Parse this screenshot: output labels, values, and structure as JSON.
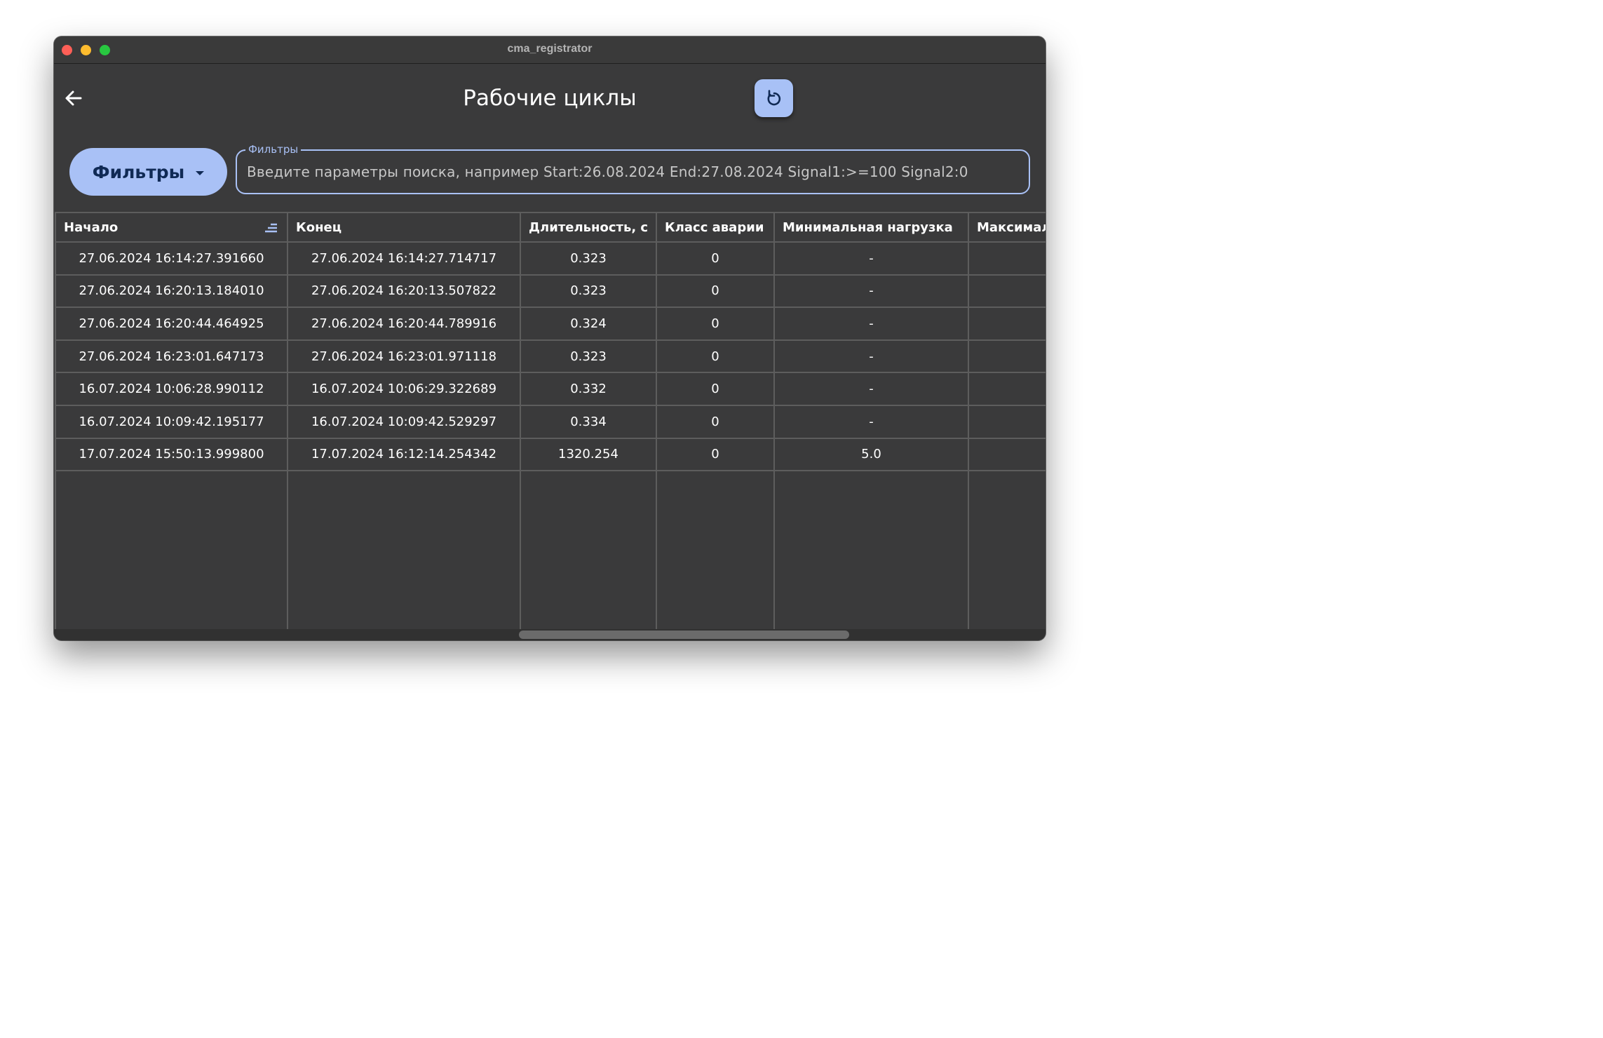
{
  "window": {
    "title": "cma_registrator"
  },
  "header": {
    "title": "Рабочие циклы",
    "back_icon": "arrow-left-icon",
    "refresh_icon": "refresh-icon"
  },
  "filters": {
    "button_label": "Фильтры",
    "field_label": "Фильтры",
    "placeholder": "Введите параметры поиска, например Start:26.08.2024 End:27.08.2024 Signal1:>=100 Signal2:0",
    "value": ""
  },
  "colors": {
    "accent": "#a9c1f6",
    "background": "#3a3a3b",
    "grid": "#5d5d5d"
  },
  "table": {
    "columns": [
      "Начало",
      "Конец",
      "Длительность, с",
      "Класс аварии",
      "Минимальная нагрузка",
      "Максимальная нагрузка"
    ],
    "sorted_column": "Начало",
    "rows": [
      [
        "27.06.2024 16:14:27.391660",
        "27.06.2024 16:14:27.714717",
        "0.323",
        "0",
        "-",
        ""
      ],
      [
        "27.06.2024 16:20:13.184010",
        "27.06.2024 16:20:13.507822",
        "0.323",
        "0",
        "-",
        ""
      ],
      [
        "27.06.2024 16:20:44.464925",
        "27.06.2024 16:20:44.789916",
        "0.324",
        "0",
        "-",
        ""
      ],
      [
        "27.06.2024 16:23:01.647173",
        "27.06.2024 16:23:01.971118",
        "0.323",
        "0",
        "-",
        ""
      ],
      [
        "16.07.2024 10:06:28.990112",
        "16.07.2024 10:06:29.322689",
        "0.332",
        "0",
        "-",
        ""
      ],
      [
        "16.07.2024 10:09:42.195177",
        "16.07.2024 10:09:42.529297",
        "0.334",
        "0",
        "-",
        ""
      ],
      [
        "17.07.2024 15:50:13.999800",
        "17.07.2024 16:12:14.254342",
        "1320.254",
        "0",
        "5.0",
        ""
      ]
    ]
  }
}
